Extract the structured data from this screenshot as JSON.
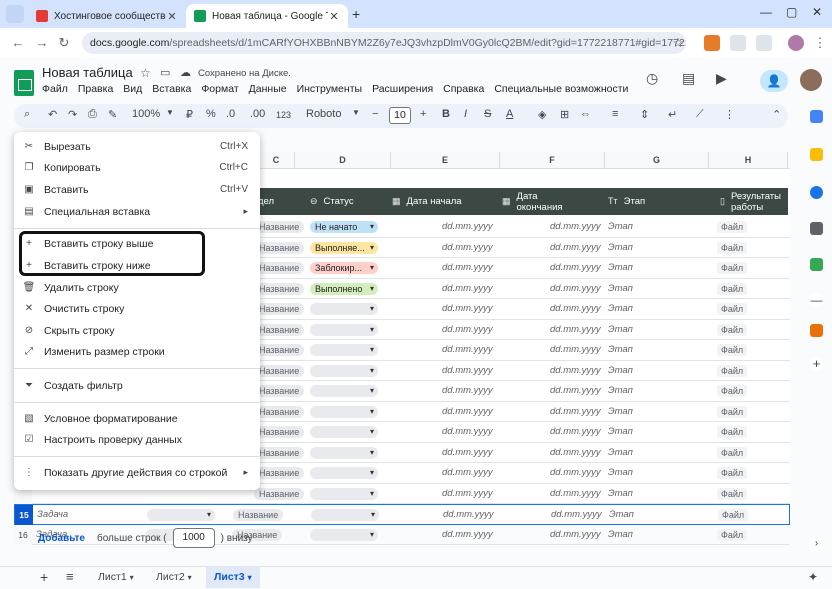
{
  "browser": {
    "tabs": [
      {
        "title": "Хостинговое сообщество «Tim",
        "favicon_color": "#e53935",
        "active": false
      },
      {
        "title": "Новая таблица - Google Табли",
        "favicon_color": "#0f9d58",
        "active": true
      }
    ],
    "url_host": "docs.google.com",
    "url_path": "/spreadsheets/d/1mCARfYOHXBBnNBYM2Z6y7eJQ3vhzpDlmV0Gy0lcQ2BM/edit?gid=1772218771#gid=1772218771"
  },
  "doc": {
    "title": "Новая таблица",
    "saved_status": "Сохранено на Диске.",
    "menu": [
      "Файл",
      "Правка",
      "Вид",
      "Вставка",
      "Формат",
      "Данные",
      "Инструменты",
      "Расширения",
      "Справка",
      "Специальные возможности"
    ]
  },
  "toolbar": {
    "zoom": "100%",
    "format_123": "123",
    "font": "Roboto",
    "font_size": "10"
  },
  "columns": [
    "C",
    "D",
    "E",
    "F",
    "G",
    "H"
  ],
  "table_header": {
    "col_c": "дел",
    "status": "Статус",
    "start": "Дата начала",
    "end": "Дата окончания",
    "stage": "Этап",
    "results": "Результаты работы"
  },
  "rows": [
    {
      "num": "",
      "tag": "Название",
      "status": "Не начато",
      "status_color": "#bfe1f6",
      "start": "dd.mm.yyyy",
      "end": "dd.mm.yyyy",
      "stage": "Этап",
      "file": "Файл"
    },
    {
      "num": "",
      "tag": "Название",
      "status": "Выполняе...",
      "status_color": "#ffe5a0",
      "start": "dd.mm.yyyy",
      "end": "dd.mm.yyyy",
      "stage": "Этап",
      "file": "Файл"
    },
    {
      "num": "",
      "tag": "Название",
      "status": "Заблокир...",
      "status_color": "#ffcfc9",
      "start": "dd.mm.yyyy",
      "end": "dd.mm.yyyy",
      "stage": "Этап",
      "file": "Файл"
    },
    {
      "num": "",
      "tag": "Название",
      "status": "Выполнено",
      "status_color": "#d4edbc",
      "start": "dd.mm.yyyy",
      "end": "dd.mm.yyyy",
      "stage": "Этап",
      "file": "Файл"
    },
    {
      "num": "",
      "tag": "Название",
      "status": "",
      "status_color": "#e8eaed",
      "start": "dd.mm.yyyy",
      "end": "dd.mm.yyyy",
      "stage": "Этап",
      "file": "Файл"
    },
    {
      "num": "",
      "tag": "Название",
      "status": "",
      "status_color": "#e8eaed",
      "start": "dd.mm.yyyy",
      "end": "dd.mm.yyyy",
      "stage": "Этап",
      "file": "Файл"
    },
    {
      "num": "",
      "tag": "Название",
      "status": "",
      "status_color": "#e8eaed",
      "start": "dd.mm.yyyy",
      "end": "dd.mm.yyyy",
      "stage": "Этап",
      "file": "Файл"
    },
    {
      "num": "",
      "tag": "Название",
      "status": "",
      "status_color": "#e8eaed",
      "start": "dd.mm.yyyy",
      "end": "dd.mm.yyyy",
      "stage": "Этап",
      "file": "Файл"
    },
    {
      "num": "",
      "tag": "Название",
      "status": "",
      "status_color": "#e8eaed",
      "start": "dd.mm.yyyy",
      "end": "dd.mm.yyyy",
      "stage": "Этап",
      "file": "Файл"
    },
    {
      "num": "",
      "tag": "Название",
      "status": "",
      "status_color": "#e8eaed",
      "start": "dd.mm.yyyy",
      "end": "dd.mm.yyyy",
      "stage": "Этап",
      "file": "Файл"
    },
    {
      "num": "",
      "tag": "Название",
      "status": "",
      "status_color": "#e8eaed",
      "start": "dd.mm.yyyy",
      "end": "dd.mm.yyyy",
      "stage": "Этап",
      "file": "Файл"
    },
    {
      "num": "",
      "tag": "Название",
      "status": "",
      "status_color": "#e8eaed",
      "start": "dd.mm.yyyy",
      "end": "dd.mm.yyyy",
      "stage": "Этап",
      "file": "Файл"
    },
    {
      "num": "",
      "tag": "Название",
      "status": "",
      "status_color": "#e8eaed",
      "start": "dd.mm.yyyy",
      "end": "dd.mm.yyyy",
      "stage": "Этап",
      "file": "Файл"
    },
    {
      "num": "",
      "tag": "Название",
      "status": "",
      "status_color": "#e8eaed",
      "start": "dd.mm.yyyy",
      "end": "dd.mm.yyyy",
      "stage": "Этап",
      "file": "Файл"
    },
    {
      "num": "15",
      "task": "Задача",
      "tag": "Название",
      "status": "",
      "status_color": "#e8eaed",
      "start": "dd.mm.yyyy",
      "end": "dd.mm.yyyy",
      "stage": "Этап",
      "file": "Файл"
    },
    {
      "num": "16",
      "task": "Задача",
      "tag": "Название",
      "status": "",
      "status_color": "#e8eaed",
      "start": "dd.mm.yyyy",
      "end": "dd.mm.yyyy",
      "stage": "Этап",
      "file": "Файл"
    }
  ],
  "footer": {
    "add_label": "Добавьте",
    "more_rows": "больше строк (",
    "count": "1000",
    "below": ") внизу"
  },
  "sheets": [
    {
      "name": "Лист1",
      "active": false
    },
    {
      "name": "Лист2",
      "active": false
    },
    {
      "name": "Лист3",
      "active": true
    }
  ],
  "context_menu": {
    "cut": {
      "label": "Вырезать",
      "shortcut": "Ctrl+X"
    },
    "copy": {
      "label": "Копировать",
      "shortcut": "Ctrl+C"
    },
    "paste": {
      "label": "Вставить",
      "shortcut": "Ctrl+V"
    },
    "paste_special": {
      "label": "Специальная вставка"
    },
    "insert_above": {
      "label": "Вставить строку выше"
    },
    "insert_below": {
      "label": "Вставить строку ниже"
    },
    "delete_row": {
      "label": "Удалить строку"
    },
    "clear_row": {
      "label": "Очистить строку"
    },
    "hide_row": {
      "label": "Скрыть строку"
    },
    "resize_row": {
      "label": "Изменить размер строки"
    },
    "create_filter": {
      "label": "Создать фильтр"
    },
    "cond_format": {
      "label": "Условное форматирование"
    },
    "data_validation": {
      "label": "Настроить проверку данных"
    },
    "more_actions": {
      "label": "Показать другие действия со строкой"
    }
  },
  "colors": {
    "accent": "#0b57d0",
    "table_header_bg": "#3b4844",
    "highlight_frame": "#111111"
  }
}
